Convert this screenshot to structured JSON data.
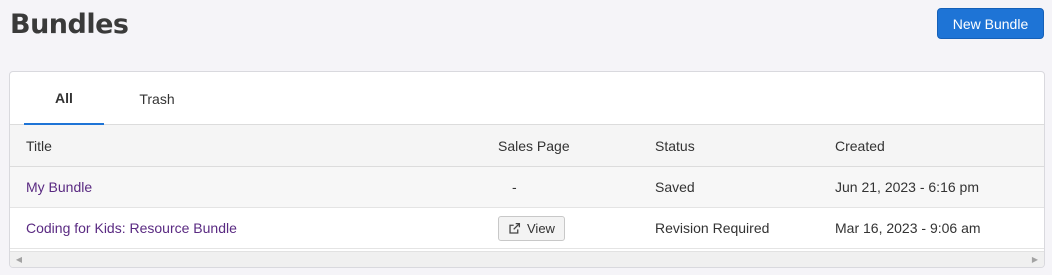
{
  "page": {
    "title": "Bundles"
  },
  "header": {
    "new_bundle_label": "New Bundle"
  },
  "tabs": [
    {
      "label": "All",
      "active": true
    },
    {
      "label": "Trash",
      "active": false
    }
  ],
  "table": {
    "columns": [
      "Title",
      "Sales Page",
      "Status",
      "Created"
    ],
    "rows": [
      {
        "title": "My Bundle",
        "sales_page": "-",
        "status": "Saved",
        "created": "Jun 21, 2023 - 6:16 pm"
      },
      {
        "title": "Coding for Kids: Resource Bundle",
        "sales_page_button": "View",
        "status": "Revision Required",
        "created": "Mar 16, 2023 - 9:06 am"
      }
    ]
  },
  "scrollbar": {
    "left_icon": "arrow-left-icon",
    "right_icon": "arrow-right-icon"
  },
  "colors": {
    "accent": "#1e74d6",
    "link": "#5a2a82",
    "background": "#f5f4f8"
  }
}
